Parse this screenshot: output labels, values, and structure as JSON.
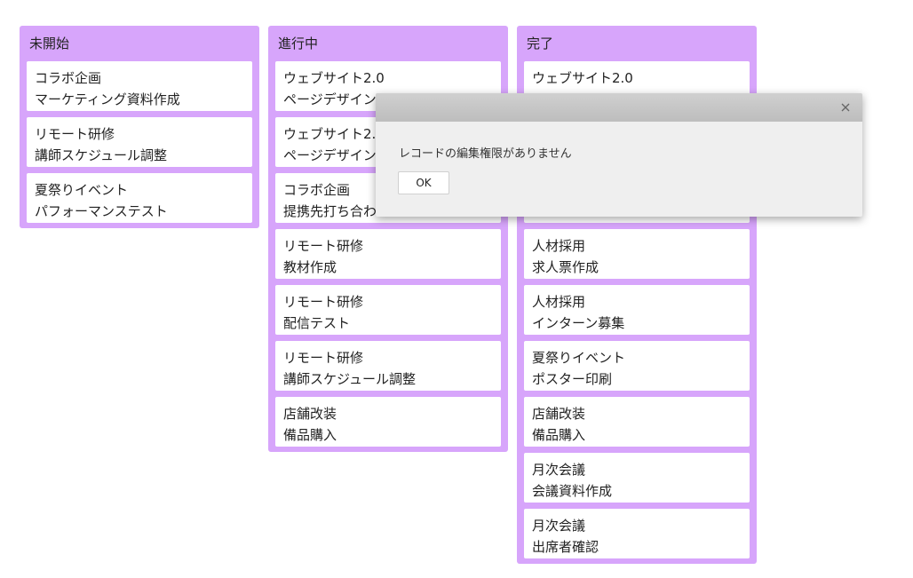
{
  "columns": [
    {
      "title": "未開始",
      "cards": [
        {
          "project": "コラボ企画",
          "task": "マーケティング資料作成"
        },
        {
          "project": "リモート研修",
          "task": "講師スケジュール調整"
        },
        {
          "project": "夏祭りイベント",
          "task": "パフォーマンステスト"
        }
      ]
    },
    {
      "title": "進行中",
      "cards": [
        {
          "project": "ウェブサイト2.0",
          "task": "ページデザイン"
        },
        {
          "project": "ウェブサイト2.0",
          "task": "ページデザイン"
        },
        {
          "project": "コラボ企画",
          "task": "提携先打ち合わせ"
        },
        {
          "project": "リモート研修",
          "task": "教材作成"
        },
        {
          "project": "リモート研修",
          "task": "配信テスト"
        },
        {
          "project": "リモート研修",
          "task": "講師スケジュール調整"
        },
        {
          "project": "店舗改装",
          "task": "備品購入"
        }
      ]
    },
    {
      "title": "完了",
      "cards": [
        {
          "project": "ウェブサイト2.0",
          "task": ""
        },
        {
          "project": "",
          "task": ""
        },
        {
          "project": "",
          "task": ""
        },
        {
          "project": "人材採用",
          "task": "求人票作成"
        },
        {
          "project": "人材採用",
          "task": "インターン募集"
        },
        {
          "project": "夏祭りイベント",
          "task": "ポスター印刷"
        },
        {
          "project": "店舗改装",
          "task": "備品購入"
        },
        {
          "project": "月次会議",
          "task": "会議資料作成"
        },
        {
          "project": "月次会議",
          "task": "出席者確認"
        }
      ]
    }
  ],
  "dialog": {
    "message": "レコードの編集権限がありません",
    "ok_label": "OK",
    "close_icon": "close-icon"
  },
  "colors": {
    "column_bg": "#d7a5fb",
    "card_bg": "#ffffff",
    "dialog_bg": "#efefef",
    "dialog_titlebar": "#c6c6c6"
  }
}
